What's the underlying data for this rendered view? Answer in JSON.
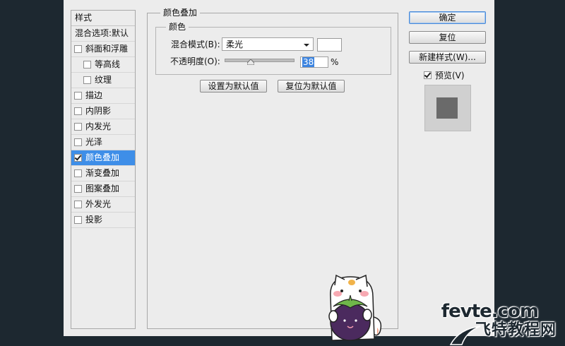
{
  "styles_panel": {
    "header": "样式",
    "blend_options": "混合选项:默认",
    "items": [
      {
        "label": "斜面和浮雕",
        "checked": false,
        "indent": false
      },
      {
        "label": "等高线",
        "checked": false,
        "indent": true
      },
      {
        "label": "纹理",
        "checked": false,
        "indent": true
      },
      {
        "label": "描边",
        "checked": false,
        "indent": false
      },
      {
        "label": "内阴影",
        "checked": false,
        "indent": false
      },
      {
        "label": "内发光",
        "checked": false,
        "indent": false
      },
      {
        "label": "光泽",
        "checked": false,
        "indent": false
      },
      {
        "label": "颜色叠加",
        "checked": true,
        "indent": false,
        "selected": true
      },
      {
        "label": "渐变叠加",
        "checked": false,
        "indent": false
      },
      {
        "label": "图案叠加",
        "checked": false,
        "indent": false
      },
      {
        "label": "外发光",
        "checked": false,
        "indent": false
      },
      {
        "label": "投影",
        "checked": false,
        "indent": false
      }
    ]
  },
  "color_overlay": {
    "group_title": "颜色叠加",
    "subgroup_title": "颜色",
    "blend_mode_label": "混合模式(B):",
    "blend_mode_value": "柔光",
    "swatch_color": "#ffffff",
    "opacity_label": "不透明度(O):",
    "opacity_value": "38",
    "opacity_unit": "%",
    "opacity_fraction": 0.38,
    "set_default_button": "设置为默认值",
    "reset_default_button": "复位为默认值"
  },
  "actions": {
    "ok": "确定",
    "reset": "复位",
    "new_style": "新建样式(W)...",
    "preview_label": "预览(V)",
    "preview_checked": true
  },
  "watermark": {
    "line1": "fevte.com",
    "line2": "飞特教程网"
  },
  "colors": {
    "background": "#1d2830",
    "dialog": "#ececec",
    "selection": "#3e8ee8",
    "preview_fill": "#6a6a6a"
  }
}
